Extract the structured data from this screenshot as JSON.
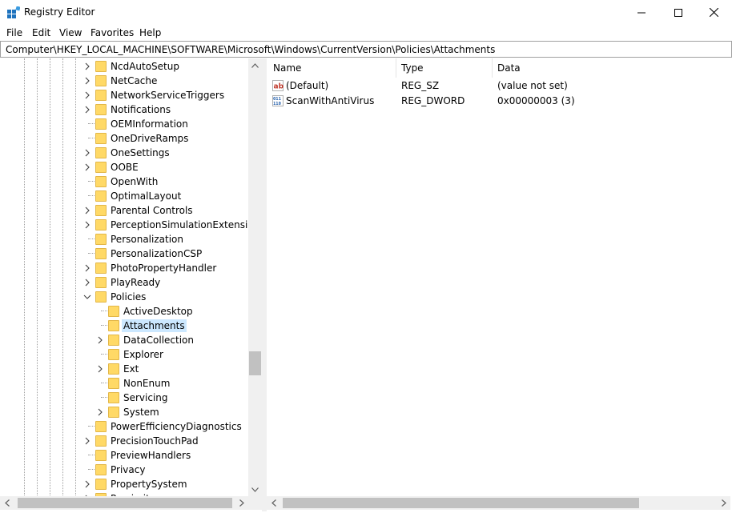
{
  "window": {
    "title": "Registry Editor"
  },
  "menu": [
    "File",
    "Edit",
    "View",
    "Favorites",
    "Help"
  ],
  "address": "Computer\\HKEY_LOCAL_MACHINE\\SOFTWARE\\Microsoft\\Windows\\CurrentVersion\\Policies\\Attachments",
  "tree": [
    {
      "label": "NcdAutoSetup",
      "expand": "collapsed"
    },
    {
      "label": "NetCache",
      "expand": "collapsed"
    },
    {
      "label": "NetworkServiceTriggers",
      "expand": "collapsed"
    },
    {
      "label": "Notifications",
      "expand": "collapsed"
    },
    {
      "label": "OEMInformation",
      "expand": "none"
    },
    {
      "label": "OneDriveRamps",
      "expand": "none"
    },
    {
      "label": "OneSettings",
      "expand": "collapsed"
    },
    {
      "label": "OOBE",
      "expand": "collapsed"
    },
    {
      "label": "OpenWith",
      "expand": "none"
    },
    {
      "label": "OptimalLayout",
      "expand": "none"
    },
    {
      "label": "Parental Controls",
      "expand": "collapsed"
    },
    {
      "label": "PerceptionSimulationExtensions",
      "expand": "collapsed"
    },
    {
      "label": "Personalization",
      "expand": "none"
    },
    {
      "label": "PersonalizationCSP",
      "expand": "none"
    },
    {
      "label": "PhotoPropertyHandler",
      "expand": "collapsed"
    },
    {
      "label": "PlayReady",
      "expand": "collapsed"
    },
    {
      "label": "Policies",
      "expand": "expanded"
    },
    {
      "label": "ActiveDesktop",
      "expand": "none",
      "child": true
    },
    {
      "label": "Attachments",
      "expand": "none",
      "child": true,
      "selected": true
    },
    {
      "label": "DataCollection",
      "expand": "collapsed",
      "child": true
    },
    {
      "label": "Explorer",
      "expand": "none",
      "child": true
    },
    {
      "label": "Ext",
      "expand": "collapsed",
      "child": true
    },
    {
      "label": "NonEnum",
      "expand": "none",
      "child": true
    },
    {
      "label": "Servicing",
      "expand": "none",
      "child": true
    },
    {
      "label": "System",
      "expand": "collapsed",
      "child": true
    },
    {
      "label": "PowerEfficiencyDiagnostics",
      "expand": "none"
    },
    {
      "label": "PrecisionTouchPad",
      "expand": "collapsed"
    },
    {
      "label": "PreviewHandlers",
      "expand": "none"
    },
    {
      "label": "Privacy",
      "expand": "none"
    },
    {
      "label": "PropertySystem",
      "expand": "collapsed"
    },
    {
      "label": "Proximity",
      "expand": "collapsed"
    }
  ],
  "columns": {
    "name": "Name",
    "type": "Type",
    "data": "Data"
  },
  "values": [
    {
      "name": "(Default)",
      "type": "REG_SZ",
      "data": "(value not set)",
      "icon": "string-value-icon"
    },
    {
      "name": "ScanWithAntiVirus",
      "type": "REG_DWORD",
      "data": "0x00000003 (3)",
      "icon": "binary-value-icon"
    }
  ],
  "colors": {
    "selection": "#cce8ff",
    "folder": "#ffd966",
    "scrollbar": "#f0f0f0",
    "thumb": "#c1c1c1"
  }
}
